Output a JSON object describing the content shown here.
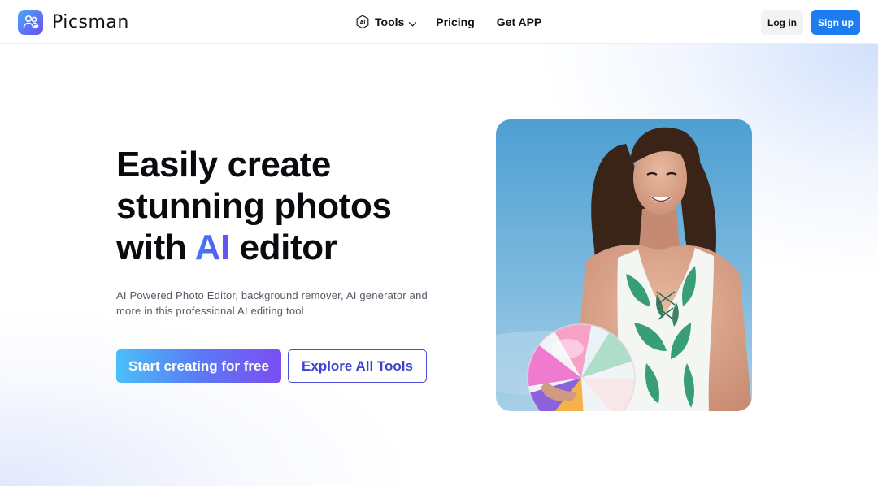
{
  "brand": {
    "name": "Picsman",
    "logo_icon": "users-icon",
    "colors": {
      "logo_start": "#4aa8f7",
      "logo_end": "#6a4ef0"
    }
  },
  "nav": {
    "tools_label": "Tools",
    "tools_icon": "ai-hexagon-icon",
    "tools_badge": "AI",
    "pricing_label": "Pricing",
    "get_app_label": "Get APP"
  },
  "auth": {
    "login_label": "Log in",
    "signup_label": "Sign up",
    "colors": {
      "signup_bg": "#1c7cf0"
    }
  },
  "hero": {
    "headline_line1": "Easily create",
    "headline_line2": "stunning photos",
    "headline_line3_pre": "with ",
    "headline_line3_accent": "AI",
    "headline_line3_post": " editor",
    "subtitle": "AI Powered Photo Editor, background remover, AI generator and more in this professional AI editing tool",
    "cta_primary": "Start creating for free",
    "cta_secondary": "Explore All Tools",
    "image_subject": "woman holding beach ball against blue sky",
    "colors": {
      "accent": "#4b55e8",
      "cta_secondary_border": "#4b4fd8"
    }
  }
}
